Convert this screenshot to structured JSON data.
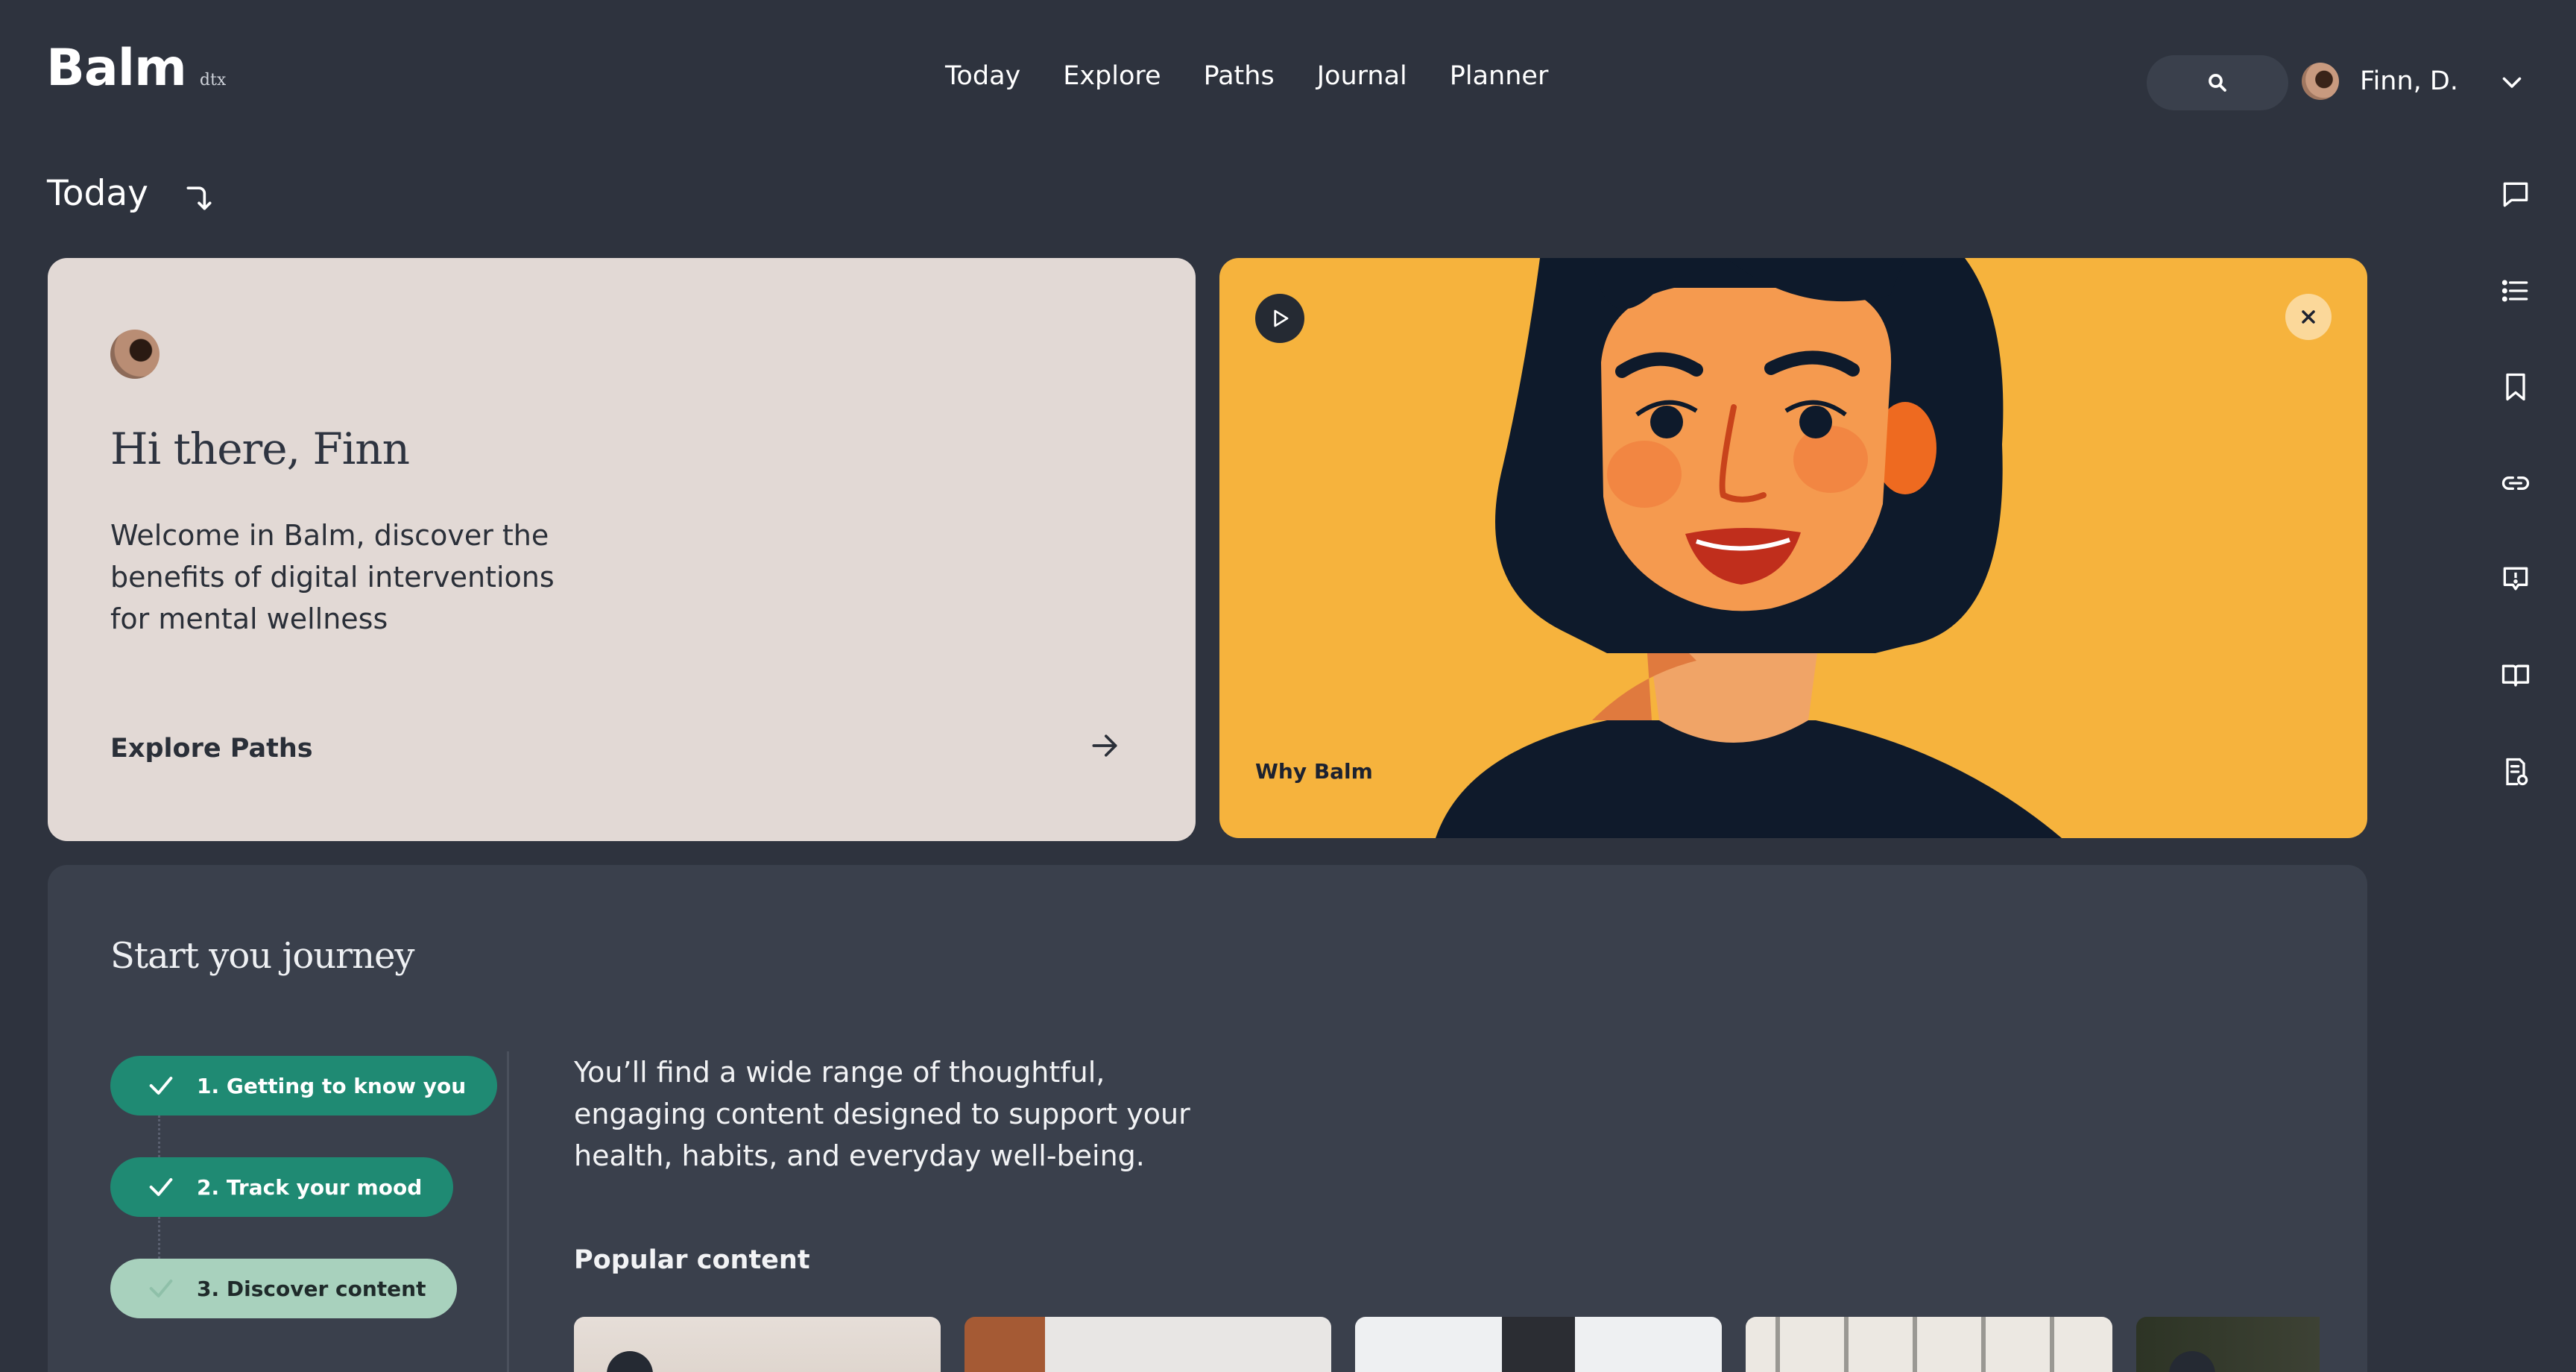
{
  "header": {
    "logo": "Balm",
    "logo_sub": "dtx",
    "nav": [
      "Today",
      "Explore",
      "Paths",
      "Journal",
      "Planner"
    ],
    "user_name": "Finn, D."
  },
  "page": {
    "title": "Today"
  },
  "welcome": {
    "greeting": "Hi there, Finn",
    "text": "Welcome in Balm, discover the benefits of digital interventions for mental wellness",
    "link": "Explore Paths"
  },
  "video": {
    "label": "Why Balm"
  },
  "journey": {
    "title": "Start you journey",
    "steps": [
      {
        "label": "1. Getting to know you",
        "done": true
      },
      {
        "label": "2. Track your mood",
        "done": true
      },
      {
        "label": "3. Discover content",
        "done": false
      }
    ],
    "text": "You’ll find a wide range of thoughtful, engaging content designed to support your health, habits, and everyday well-being.",
    "popular_title": "Popular content"
  },
  "icons": {
    "search": "search-icon",
    "rail": [
      "chat-icon",
      "list-icon",
      "bookmark-icon",
      "link-icon",
      "feedback-icon",
      "book-icon",
      "report-icon"
    ]
  },
  "colors": {
    "background": "#2e333e",
    "welcome_card": "#e2d9d5",
    "video_card": "#f6b33d",
    "step_done": "#1f8a73",
    "step_pending": "#a8d1bd"
  }
}
